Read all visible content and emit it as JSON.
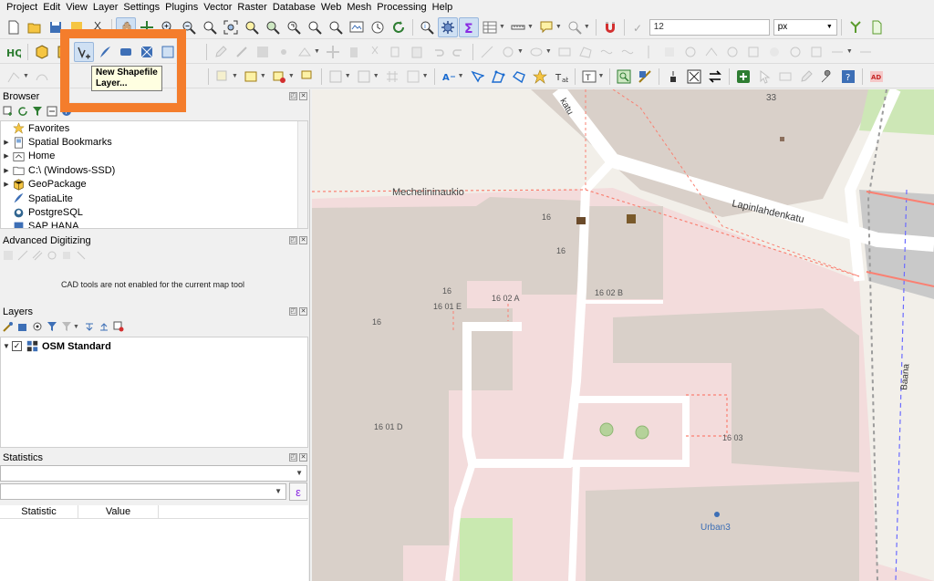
{
  "menubar": {
    "items": [
      "Project",
      "Edit",
      "View",
      "Layer",
      "Settings",
      "Plugins",
      "Vector",
      "Raster",
      "Database",
      "Web",
      "Mesh",
      "Processing",
      "Help"
    ]
  },
  "attributes_toolbar": {
    "font_size_value": "12",
    "font_unit": "px"
  },
  "tooltip": {
    "line1": "New Shapefile",
    "line2": "Layer..."
  },
  "browser_panel": {
    "title": "Browser",
    "items": [
      {
        "label": "Favorites",
        "icon": "star-icon",
        "expandable": false
      },
      {
        "label": "Spatial Bookmarks",
        "icon": "bookmark-icon",
        "expandable": true
      },
      {
        "label": "Home",
        "icon": "home-folder-icon",
        "expandable": true
      },
      {
        "label": "C:\\ (Windows-SSD)",
        "icon": "drive-folder-icon",
        "expandable": true
      },
      {
        "label": "GeoPackage",
        "icon": "geopackage-icon",
        "expandable": true
      },
      {
        "label": "SpatiaLite",
        "icon": "spatialite-icon",
        "expandable": false
      },
      {
        "label": "PostgreSQL",
        "icon": "postgresql-icon",
        "expandable": false
      },
      {
        "label": "SAP HANA",
        "icon": "sap-hana-icon",
        "expandable": false
      }
    ]
  },
  "advanced_digitizing_panel": {
    "title": "Advanced Digitizing",
    "message": "CAD tools are not enabled for the current map tool"
  },
  "layers_panel": {
    "title": "Layers",
    "layers": [
      {
        "name": "OSM Standard",
        "checked": true
      }
    ]
  },
  "statistics_panel": {
    "title": "Statistics",
    "expression_button": "ε",
    "columns": [
      "Statistic",
      "Value"
    ]
  },
  "map": {
    "labels": {
      "square": "Mechelininaukio",
      "street": "Lapinlahdenkatu",
      "street_top": "katu",
      "baana": "Baana",
      "urban3": "Urban3",
      "n33": "33",
      "n16a": "16",
      "n16b": "16",
      "n16c": "16",
      "n16d": "16",
      "b1602a": "16 02 A",
      "b1602b": "16 02 B",
      "b1601e": "16 01 E",
      "b1601d": "16 01 D",
      "b1603": "16 03"
    },
    "colors": {
      "background": "#f2efe9",
      "building": "#d9d0c9",
      "hospital_area": "#f3dcdc",
      "road": "#ffffff",
      "path_red": "#fa8072",
      "park": "#cdebb0",
      "rail": "#bdbdbd"
    }
  },
  "colors": {
    "highlight_frame": "#f47d2c",
    "tooltip_bg": "#ffffe1"
  }
}
